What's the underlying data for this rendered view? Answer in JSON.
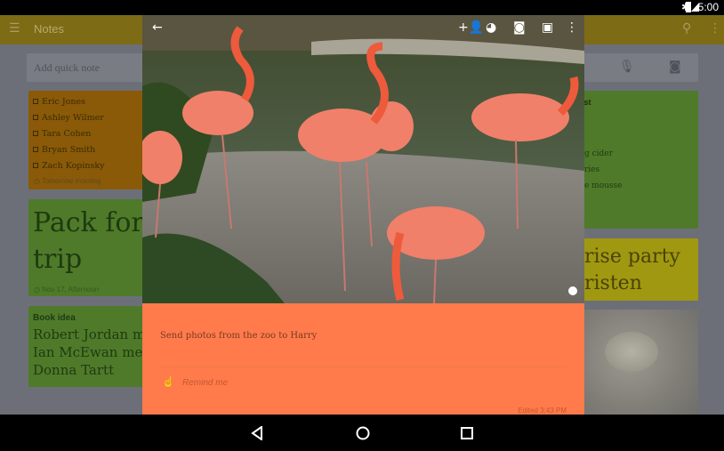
{
  "status": {
    "time": "5:00",
    "icons": [
      "bluetooth-icon",
      "signal-icon",
      "battery-icon"
    ]
  },
  "appbar": {
    "title": "Notes",
    "icons": [
      "menu-icon",
      "search-icon",
      "more-icon"
    ]
  },
  "quick_note": {
    "placeholder": "Add quick note",
    "icons": [
      "mic-icon",
      "camera-icon"
    ]
  },
  "left_cards": {
    "contacts": {
      "items": [
        "Eric Jones",
        "Ashley Wilmer",
        "Tara Cohen",
        "Bryan Smith",
        "Zach Kopinsky"
      ],
      "reminder": "Tomorrow morning",
      "color": "#8a5a08"
    },
    "trip": {
      "title": "Pack for trip",
      "reminder": "Nov 17, Afternoon",
      "color": "#4f7a2a"
    },
    "book": {
      "title": "Book idea",
      "body": [
        "Robert Jordan m",
        "Ian McEwan mee",
        "Donna Tartt"
      ],
      "color": "#4f7a2a"
    }
  },
  "right_cards": {
    "list": {
      "title": "ist",
      "items": [
        "g cider",
        "ries",
        "e mousse"
      ],
      "color": "#4f7a2a"
    },
    "party": {
      "title": "rise party",
      "title2": "risten",
      "color": "#a09810"
    }
  },
  "modal": {
    "toolbar": [
      "back-icon",
      "add-collaborator-icon",
      "palette-icon",
      "camera-icon",
      "archive-icon",
      "more-icon"
    ],
    "text": "Send photos from the zoo to Harry",
    "remind": "Remind me",
    "edited": "Edited 3:43 PM",
    "color": "#ff7b4c"
  },
  "nav": [
    "back-icon",
    "home-icon",
    "recents-icon"
  ]
}
